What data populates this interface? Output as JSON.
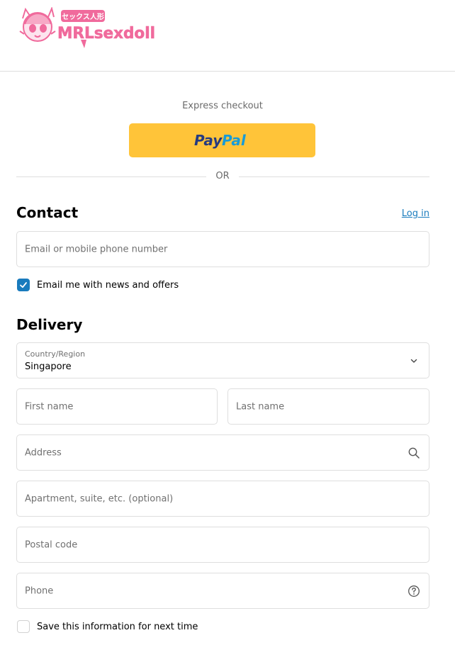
{
  "brand": {
    "logo_text": "MRLsexdoll",
    "logo_subtext": "セックス人形"
  },
  "express": {
    "label": "Express checkout",
    "paypal_label_a": "Pay",
    "paypal_label_b": "Pal"
  },
  "divider": {
    "text": "OR"
  },
  "contact": {
    "title": "Contact",
    "login_link": "Log in",
    "email_placeholder": "Email or mobile phone number",
    "newsletter_label": "Email me with news and offers",
    "newsletter_checked": true
  },
  "delivery": {
    "title": "Delivery",
    "country_label": "Country/Region",
    "country_value": "Singapore",
    "first_name_placeholder": "First name",
    "last_name_placeholder": "Last name",
    "address_placeholder": "Address",
    "apartment_placeholder": "Apartment, suite, etc. (optional)",
    "postal_placeholder": "Postal code",
    "phone_placeholder": "Phone",
    "save_info_label": "Save this information for next time",
    "save_info_checked": false
  },
  "colors": {
    "accent": "#197bbd",
    "paypal_yellow": "#ffc439",
    "paypal_navy": "#253b80",
    "paypal_blue": "#179bd7",
    "logo_pink": "#f06a9c",
    "border": "#dedede"
  },
  "icons": {
    "country_dropdown": "chevron-down-icon",
    "address_search": "search-icon",
    "phone_help": "help-circle-icon",
    "checkbox_mark": "check-icon"
  }
}
